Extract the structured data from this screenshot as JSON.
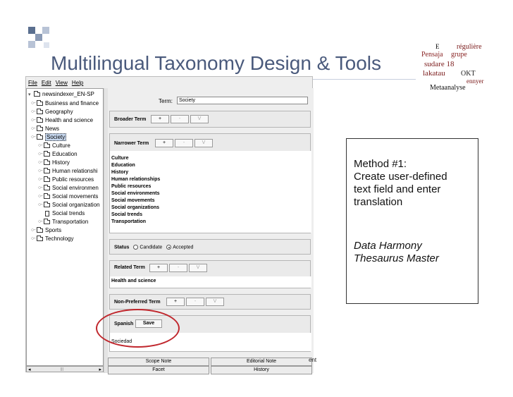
{
  "slide": {
    "title": "Multilingual Taxonomy Design & Tools",
    "stray_text": "ent"
  },
  "cloud": {
    "words": [
      "E",
      "régulière",
      "Pensaja",
      "grupe",
      "sudare 18",
      "lakatau",
      "OKT",
      "ennyer",
      "Metaanalyse"
    ]
  },
  "app": {
    "menu": [
      "File",
      "Edit",
      "View",
      "Help"
    ],
    "tree": {
      "root": "newsindexer_EN-SP",
      "items": [
        "Business and finance",
        "Geography",
        "Health and science",
        "News",
        "Society",
        "Culture",
        "Education",
        "History",
        "Human relationshi",
        "Public resources",
        "Social environmen",
        "Social movements",
        "Social organization",
        "Social trends",
        "Transportation",
        "Sports",
        "Technology"
      ]
    },
    "term": {
      "label": "Term:",
      "value": "Society"
    },
    "buttons": {
      "add": "+",
      "remove": "-",
      "view": "V"
    },
    "broader": {
      "label": "Broader Term"
    },
    "narrower": {
      "label": "Narrower Term",
      "items": [
        "Culture",
        "Education",
        "History",
        "Human relationships",
        "Public resources",
        "Social environments",
        "Social movements",
        "Social organizations",
        "Social trends",
        "Transportation"
      ]
    },
    "status": {
      "label": "Status",
      "option_candidate": "Candidate",
      "option_accepted": "Accepted",
      "selected": "Accepted"
    },
    "related": {
      "label": "Related Term",
      "items": [
        "Health and science"
      ]
    },
    "nonpreferred": {
      "label": "Non-Preferred Term"
    },
    "translation": {
      "label": "Spanish",
      "save": "Save",
      "value": "Sociedad"
    },
    "bottom": {
      "scope_note": "Scope Note",
      "editorial_note": "Editorial Note",
      "facet": "Facet",
      "history": "History"
    }
  },
  "callout": {
    "line1": "Method #1:",
    "line2": "Create user-defined",
    "line3": "text field and enter",
    "line4": "translation",
    "product1": "Data Harmony",
    "product2": "Thesaurus Master"
  },
  "colors": {
    "title": "#4a5a7c",
    "highlight": "#c0272d",
    "selection": "#c6d7ee"
  }
}
